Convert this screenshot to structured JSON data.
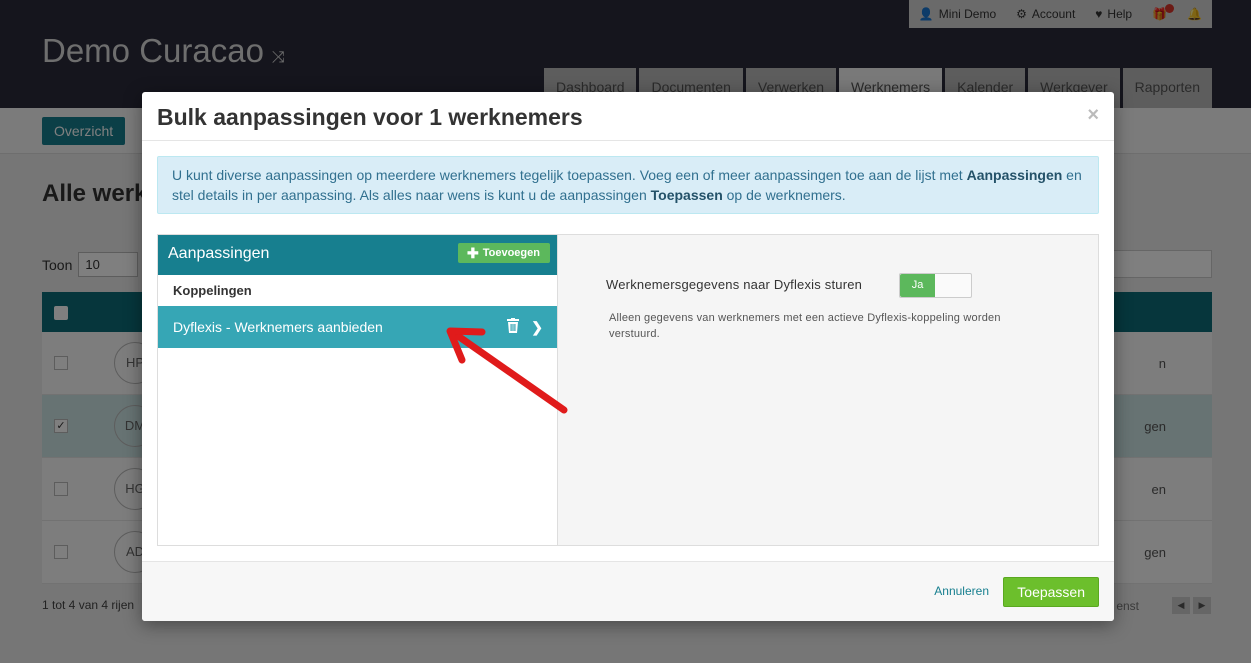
{
  "usermenu": {
    "user": "Mini Demo",
    "account": "Account",
    "help": "Help"
  },
  "company": "Demo Curacao",
  "nav": {
    "tabs": [
      "Dashboard",
      "Documenten",
      "Verwerken",
      "Werknemers",
      "Kalender",
      "Werkgever",
      "Rapporten"
    ],
    "active": "Werknemers"
  },
  "subnav": {
    "overzicht": "Overzicht"
  },
  "page": {
    "title": "Alle werk",
    "toon_label": "Toon",
    "toon_value": "10",
    "rows": [
      {
        "initials": "HP",
        "tail": "n",
        "checked": false
      },
      {
        "initials": "DM",
        "tail": "gen",
        "checked": true
      },
      {
        "initials": "HG",
        "tail": "en",
        "checked": false
      },
      {
        "initials": "AD",
        "tail": "gen",
        "checked": false
      }
    ],
    "footer_info": "1 tot 4 van 4 rijen",
    "pager_text": "enst"
  },
  "modal": {
    "title": "Bulk aanpassingen voor 1 werknemers",
    "close": "×",
    "info": {
      "part1": "U kunt diverse aanpassingen op meerdere werknemers tegelijk toepassen. Voeg een of meer aanpassingen toe aan de lijst met ",
      "bold1": "Aanpassingen",
      "part2": " en stel details in per aanpassing. Als alles naar wens is kunt u de aanpassingen ",
      "bold2": "Toepassen",
      "part3": " op de werknemers."
    },
    "left": {
      "title": "Aanpassingen",
      "add_button": "Toevoegen",
      "group": "Koppelingen",
      "active_item": "Dyflexis - Werknemers aanbieden"
    },
    "right": {
      "setting_label": "Werknemersgegevens naar Dyflexis sturen",
      "toggle_value": "Ja",
      "help": "Alleen gegevens van werknemers met een actieve Dyflexis-koppeling worden verstuurd."
    },
    "footer": {
      "cancel": "Annuleren",
      "apply": "Toepassen"
    }
  },
  "colors": {
    "teal": "#177f8f",
    "teal_light": "#36a6b5",
    "green": "#5cb85c",
    "apply_green": "#6cbf2c",
    "arrow_red": "#e01b1b"
  }
}
